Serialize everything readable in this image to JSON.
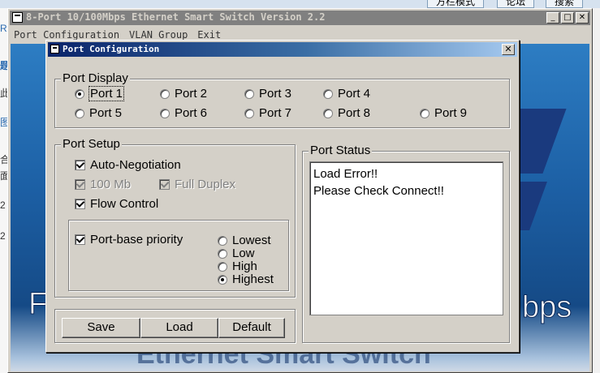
{
  "background": {
    "tabs": [
      "方栏模式",
      "论坛",
      "搜索"
    ],
    "left_chars": [
      "R",
      "题",
      "此",
      "图",
      "合",
      "面",
      "2",
      "2"
    ],
    "banner_left_char": "F",
    "banner_right_text": "bps",
    "banner_bottom_text": "Ethernet Smart Switch"
  },
  "app": {
    "title": "8-Port 10/100Mbps Ethernet Smart Switch Version 2.2",
    "menu": [
      "Port Configuration",
      "VLAN Group",
      "Exit"
    ],
    "controls": {
      "minimize": "_",
      "maximize": "□",
      "close": "✕"
    }
  },
  "dialog": {
    "title": "Port Configuration",
    "close_glyph": "✕",
    "port_display": {
      "label": "Port  Display",
      "ports": [
        "Port 1",
        "Port 2",
        "Port 3",
        "Port 4",
        "Port 5",
        "Port 6",
        "Port 7",
        "Port 8",
        "Port 9"
      ],
      "selected": "Port 1"
    },
    "port_setup": {
      "label": "Port Setup",
      "auto_negotiation": {
        "label": "Auto-Negotiation",
        "checked": true
      },
      "speed_100mb": {
        "label": "100 Mb",
        "checked": true,
        "disabled": true
      },
      "full_duplex": {
        "label": "Full Duplex",
        "checked": true,
        "disabled": true
      },
      "flow_control": {
        "label": "Flow Control",
        "checked": true
      },
      "port_base_priority": {
        "label": "Port-base priority",
        "checked": true
      },
      "priority_levels": [
        "Lowest",
        "Low",
        "High",
        "Highest"
      ],
      "priority_selected": "Highest"
    },
    "port_status": {
      "label": "Port Status",
      "lines": [
        "Load Error!!",
        "Please Check Connect!!"
      ]
    },
    "buttons": {
      "save": "Save",
      "load": "Load",
      "default": "Default"
    }
  }
}
